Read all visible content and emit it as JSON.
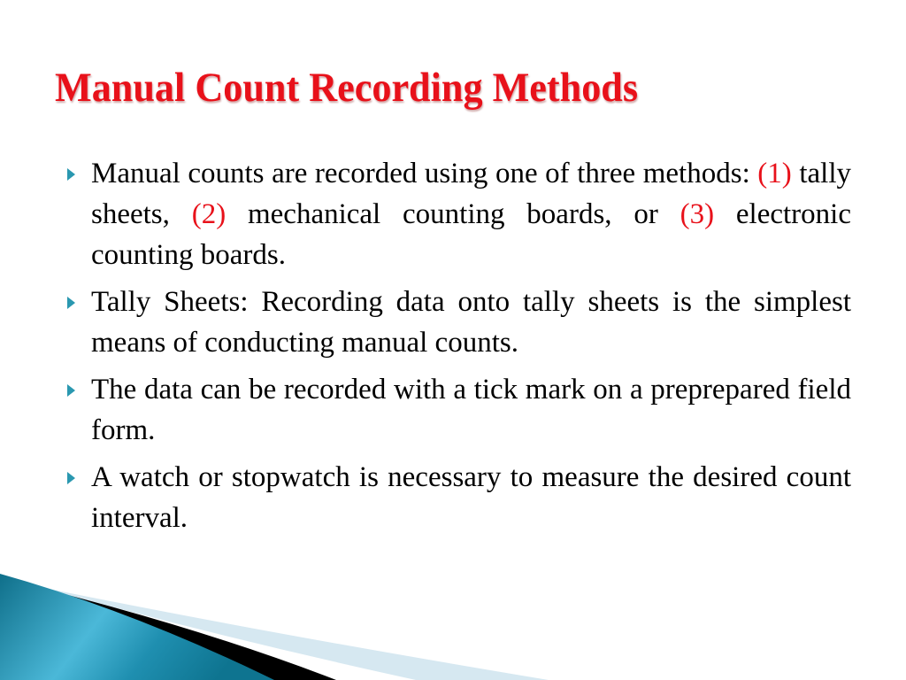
{
  "slide": {
    "title": "Manual Count Recording Methods",
    "title_color": "#e8111a",
    "accent_color": "#2a98b0",
    "bullets": [
      {
        "parts": [
          {
            "text": "Manual counts are recorded using one of three methods: ",
            "highlight": false
          },
          {
            "text": "(1)",
            "highlight": true
          },
          {
            "text": " tally sheets, ",
            "highlight": false
          },
          {
            "text": "(2)",
            "highlight": true
          },
          {
            "text": " mechanical counting boards, or ",
            "highlight": false
          },
          {
            "text": "(3)",
            "highlight": true
          },
          {
            "text": " electronic counting boards.",
            "highlight": false
          }
        ]
      },
      {
        "parts": [
          {
            "text": "Tally Sheets: Recording data onto tally sheets is the simplest means of conducting manual counts.",
            "highlight": false
          }
        ]
      },
      {
        "parts": [
          {
            "text": "The data can be recorded with a tick mark on a preprepared field form.",
            "highlight": false
          }
        ]
      },
      {
        "parts": [
          {
            "text": "A watch or stopwatch is necessary to measure the desired count interval.",
            "highlight": false
          }
        ]
      }
    ],
    "bullet_icon": "triangle-right-bullet-icon",
    "footer_decoration": "teal-swoosh-wave"
  }
}
